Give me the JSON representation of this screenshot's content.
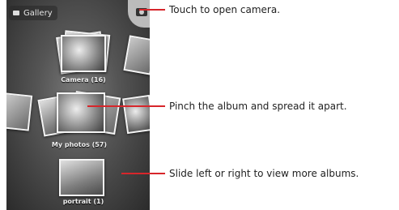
{
  "header": {
    "app_label": "Gallery"
  },
  "albums": [
    {
      "label": "Camera (16)"
    },
    {
      "label": "My photos (57)"
    },
    {
      "label": "portrait (1)"
    }
  ],
  "callouts": [
    {
      "text": "Touch to open camera."
    },
    {
      "text": "Pinch the album and spread it apart."
    },
    {
      "text": "Slide left or right to view more albums."
    }
  ],
  "colors": {
    "callout_line": "#d7262b"
  }
}
